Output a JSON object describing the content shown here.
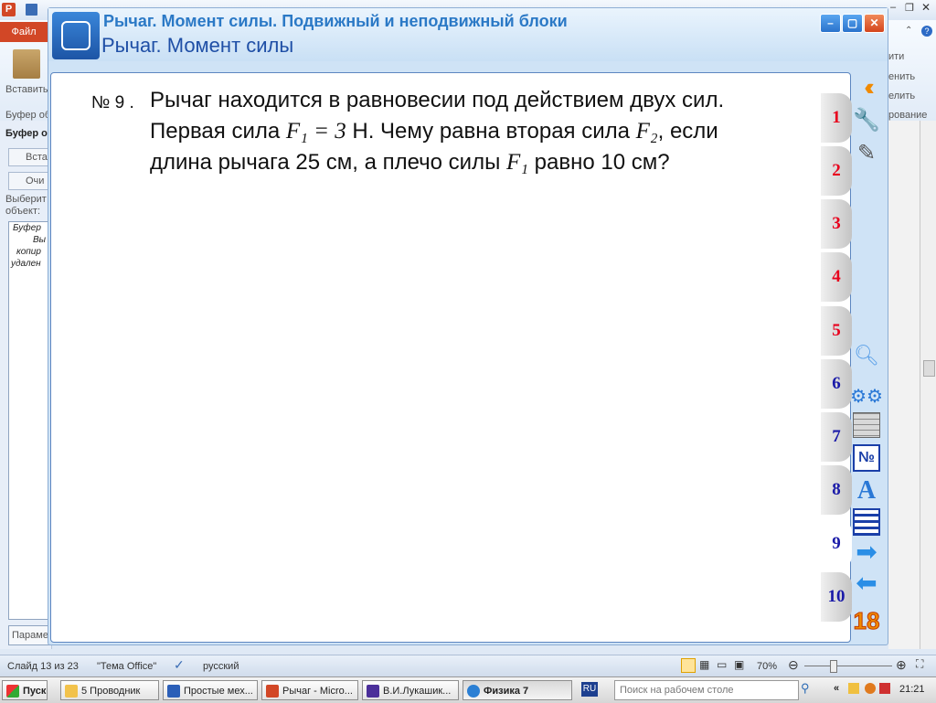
{
  "powerpoint": {
    "file_tab": "Файл",
    "paste_label": "Вставить",
    "clipboard_group": "Буфер об",
    "right_labels": [
      "ити",
      "енить",
      "елить",
      "рование"
    ],
    "clipboard_pane_title": "Буфер о",
    "pane_btn_paste": "Вста",
    "pane_btn_clear": "Очи",
    "pane_select_text": "Выберит объект:",
    "clip_lines": [
      "Буфер",
      "Вы",
      "копир",
      "удален"
    ],
    "params_button": "Парамет"
  },
  "status_bar": {
    "slide": "Слайд 13 из 23",
    "theme": "\"Тема Office\"",
    "language": "русский",
    "zoom": "70%"
  },
  "taskbar": {
    "start": "Пуск",
    "items": [
      "5 Проводник",
      "Простые мех...",
      "Рычаг - Micro...",
      "В.И.Лукашик...",
      "Физика 7"
    ],
    "lang": "RU",
    "search_placeholder": "Поиск на рабочем столе",
    "clock": "21:21"
  },
  "app": {
    "title": "Рычаг. Момент силы. Подвижный и неподвижный блоки",
    "subtitle": "Рычаг. Момент силы",
    "problem_label": "№ 9 .",
    "problem": {
      "l1": "Рычаг находится в равновесии под действием двух сил.",
      "l2_a": "Первая сила ",
      "l2_f1": "F₁ = 3",
      "l2_b": " Н. Чему равна вторая сила ",
      "l2_f2": "F₂",
      "l2_c": ", если",
      "l3_a": "длина рычага 25 см, а плечо силы ",
      "l3_f1": "F₁",
      "l3_b": " равно 10 см?"
    },
    "tabs": [
      "1",
      "2",
      "3",
      "4",
      "5",
      "6",
      "7",
      "8",
      "9",
      "10"
    ],
    "active_tab": "9",
    "tab_colors": {
      "red": "#e8001c",
      "blue": "#1a1aa8"
    },
    "tool_badge_number": "18",
    "numbered_icon_text": "№",
    "letter_icon_text": "A"
  }
}
